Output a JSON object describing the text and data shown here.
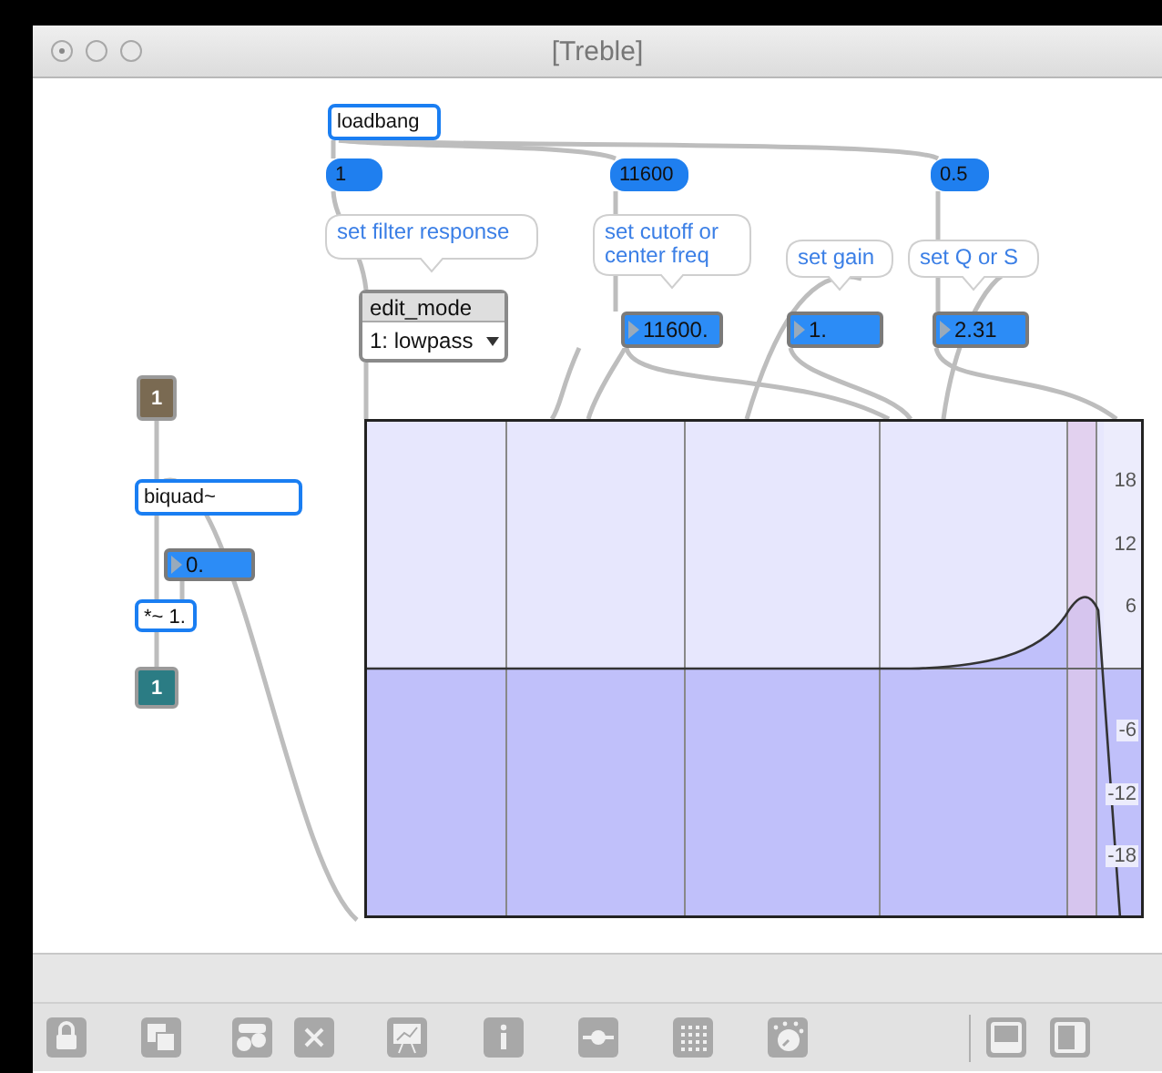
{
  "window": {
    "title": "[Treble]"
  },
  "patcher": {
    "objects": [
      {
        "kind": "object",
        "text": "loadbang",
        "selected": true
      },
      {
        "kind": "message",
        "text": "1",
        "selected": false
      },
      {
        "kind": "message",
        "text": "11600",
        "selected": false
      },
      {
        "kind": "message",
        "text": "0.5",
        "selected": false
      },
      {
        "kind": "comment",
        "text": "set filter response",
        "selected": false
      },
      {
        "kind": "comment",
        "text": "set cutoff or center freq",
        "selected": false
      },
      {
        "kind": "comment",
        "text": "set gain",
        "selected": false
      },
      {
        "kind": "comment",
        "text": "set Q or S",
        "selected": false
      },
      {
        "kind": "menu",
        "title": "edit_mode",
        "value": "1: lowpass",
        "selected": false
      },
      {
        "kind": "number",
        "text": "11600.",
        "selected": false
      },
      {
        "kind": "number",
        "text": "1.",
        "selected": false
      },
      {
        "kind": "number",
        "text": "2.31",
        "selected": false
      },
      {
        "kind": "inlet",
        "text": "1",
        "selected": false
      },
      {
        "kind": "object",
        "text": "biquad~",
        "selected": true
      },
      {
        "kind": "number",
        "text": "0.",
        "selected": false
      },
      {
        "kind": "object",
        "text": "*~ 1.",
        "selected": true
      },
      {
        "kind": "outlet",
        "text": "1",
        "selected": false
      }
    ]
  },
  "filter_graph": {
    "axis_labels": [
      "18",
      "12",
      "6",
      "-6",
      "-12",
      "-18"
    ]
  }
}
